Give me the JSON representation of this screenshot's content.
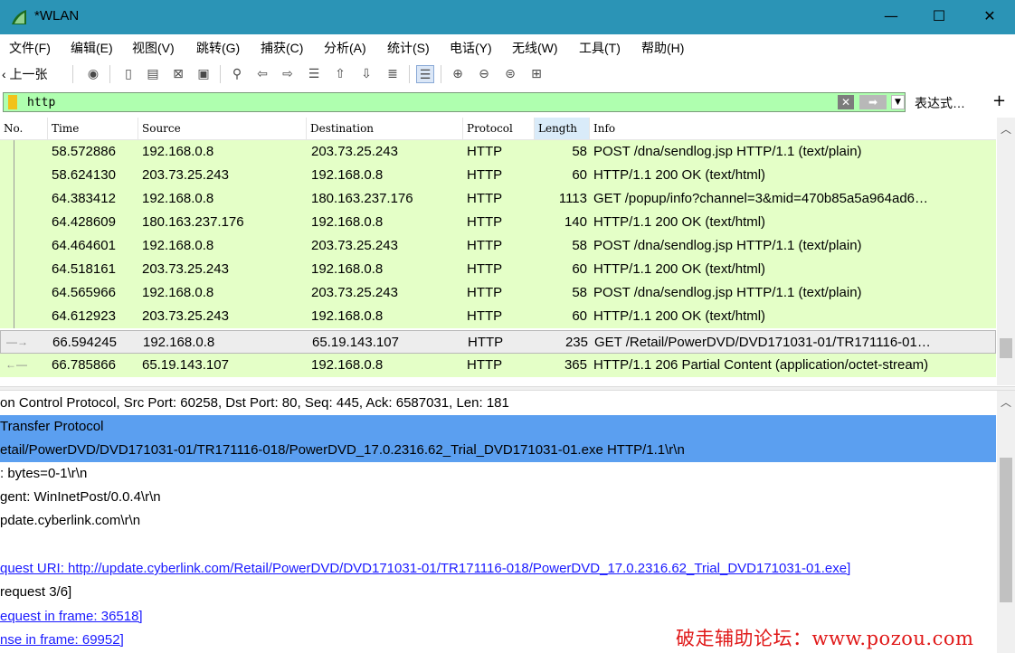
{
  "window": {
    "title": "*WLAN",
    "minimize": "—",
    "maximize": "☐",
    "close": "✕"
  },
  "menu": [
    "文件(F)",
    "编辑(E)",
    "视图(V)",
    "跳转(G)",
    "捕获(C)",
    "分析(A)",
    "统计(S)",
    "电话(Y)",
    "无线(W)",
    "工具(T)",
    "帮助(H)"
  ],
  "toolbar": {
    "back_label": "‹ 上一张"
  },
  "filter": {
    "value": "http",
    "expression_label": "表达式…",
    "add_label": "+"
  },
  "packet_list": {
    "columns": [
      "No.",
      "Time",
      "Source",
      "Destination",
      "Protocol",
      "Length",
      "Info"
    ],
    "sorted_column": "Length",
    "rows": [
      {
        "time": "58.572886",
        "source": "192.168.0.8",
        "destination": "203.73.25.243",
        "protocol": "HTTP",
        "length": "58",
        "info": "POST /dna/sendlog.jsp HTTP/1.1  (text/plain)"
      },
      {
        "time": "58.624130",
        "source": "203.73.25.243",
        "destination": "192.168.0.8",
        "protocol": "HTTP",
        "length": "60",
        "info": "HTTP/1.1 200 OK  (text/html)"
      },
      {
        "time": "64.383412",
        "source": "192.168.0.8",
        "destination": "180.163.237.176",
        "protocol": "HTTP",
        "length": "1113",
        "info": "GET /popup/info?channel=3&mid=470b85a5a964ad6…"
      },
      {
        "time": "64.428609",
        "source": "180.163.237.176",
        "destination": "192.168.0.8",
        "protocol": "HTTP",
        "length": "140",
        "info": "HTTP/1.1 200 OK  (text/html)"
      },
      {
        "time": "64.464601",
        "source": "192.168.0.8",
        "destination": "203.73.25.243",
        "protocol": "HTTP",
        "length": "58",
        "info": "POST /dna/sendlog.jsp HTTP/1.1  (text/plain)"
      },
      {
        "time": "64.518161",
        "source": "203.73.25.243",
        "destination": "192.168.0.8",
        "protocol": "HTTP",
        "length": "60",
        "info": "HTTP/1.1 200 OK  (text/html)"
      },
      {
        "time": "64.565966",
        "source": "192.168.0.8",
        "destination": "203.73.25.243",
        "protocol": "HTTP",
        "length": "58",
        "info": "POST /dna/sendlog.jsp HTTP/1.1  (text/plain)"
      },
      {
        "time": "64.612923",
        "source": "203.73.25.243",
        "destination": "192.168.0.8",
        "protocol": "HTTP",
        "length": "60",
        "info": "HTTP/1.1 200 OK  (text/html)"
      },
      {
        "time": "66.594245",
        "source": "192.168.0.8",
        "destination": "65.19.143.107",
        "protocol": "HTTP",
        "length": "235",
        "info": "GET /Retail/PowerDVD/DVD171031-01/TR171116-01…"
      },
      {
        "time": "66.785866",
        "source": "65.19.143.107",
        "destination": "192.168.0.8",
        "protocol": "HTTP",
        "length": "365",
        "info": "HTTP/1.1 206 Partial Content  (application/octet-stream)"
      }
    ]
  },
  "details": {
    "lines": [
      "on Control Protocol, Src Port: 60258, Dst Port: 80, Seq: 445, Ack: 6587031, Len: 181",
      " Transfer Protocol",
      "etail/PowerDVD/DVD171031-01/TR171116-018/PowerDVD_17.0.2316.62_Trial_DVD171031-01.exe HTTP/1.1\\r\\n",
      ": bytes=0-1\\r\\n",
      "gent: WinInetPost/0.0.4\\r\\n",
      "pdate.cyberlink.com\\r\\n",
      "",
      "quest URI: http://update.cyberlink.com/Retail/PowerDVD/DVD171031-01/TR171116-018/PowerDVD_17.0.2316.62_Trial_DVD171031-01.exe]",
      "request 3/6]",
      "equest in frame: 36518]",
      "nse in frame: 69952]"
    ]
  },
  "watermark": "破走辅助论坛：www.pozou.com",
  "colors": {
    "titlebar": "#2b94b6",
    "row_http": "#e4ffc7",
    "row_selected": "#ededed",
    "filter_valid": "#afffaf",
    "detail_highlight": "#5b9ff0",
    "link": "#1a1aff",
    "watermark": "#e01919"
  },
  "icons": [
    "wireshark-fin-icon",
    "capture-options-icon",
    "open-file-icon",
    "save-file-icon",
    "close-file-icon",
    "reload-icon",
    "find-packet-icon",
    "go-back-icon",
    "go-forward-icon",
    "go-to-packet-icon",
    "first-packet-icon",
    "last-packet-icon",
    "autoscroll-icon",
    "colorize-icon",
    "zoom-in-icon",
    "zoom-out-icon",
    "normal-size-icon",
    "resize-columns-icon"
  ]
}
